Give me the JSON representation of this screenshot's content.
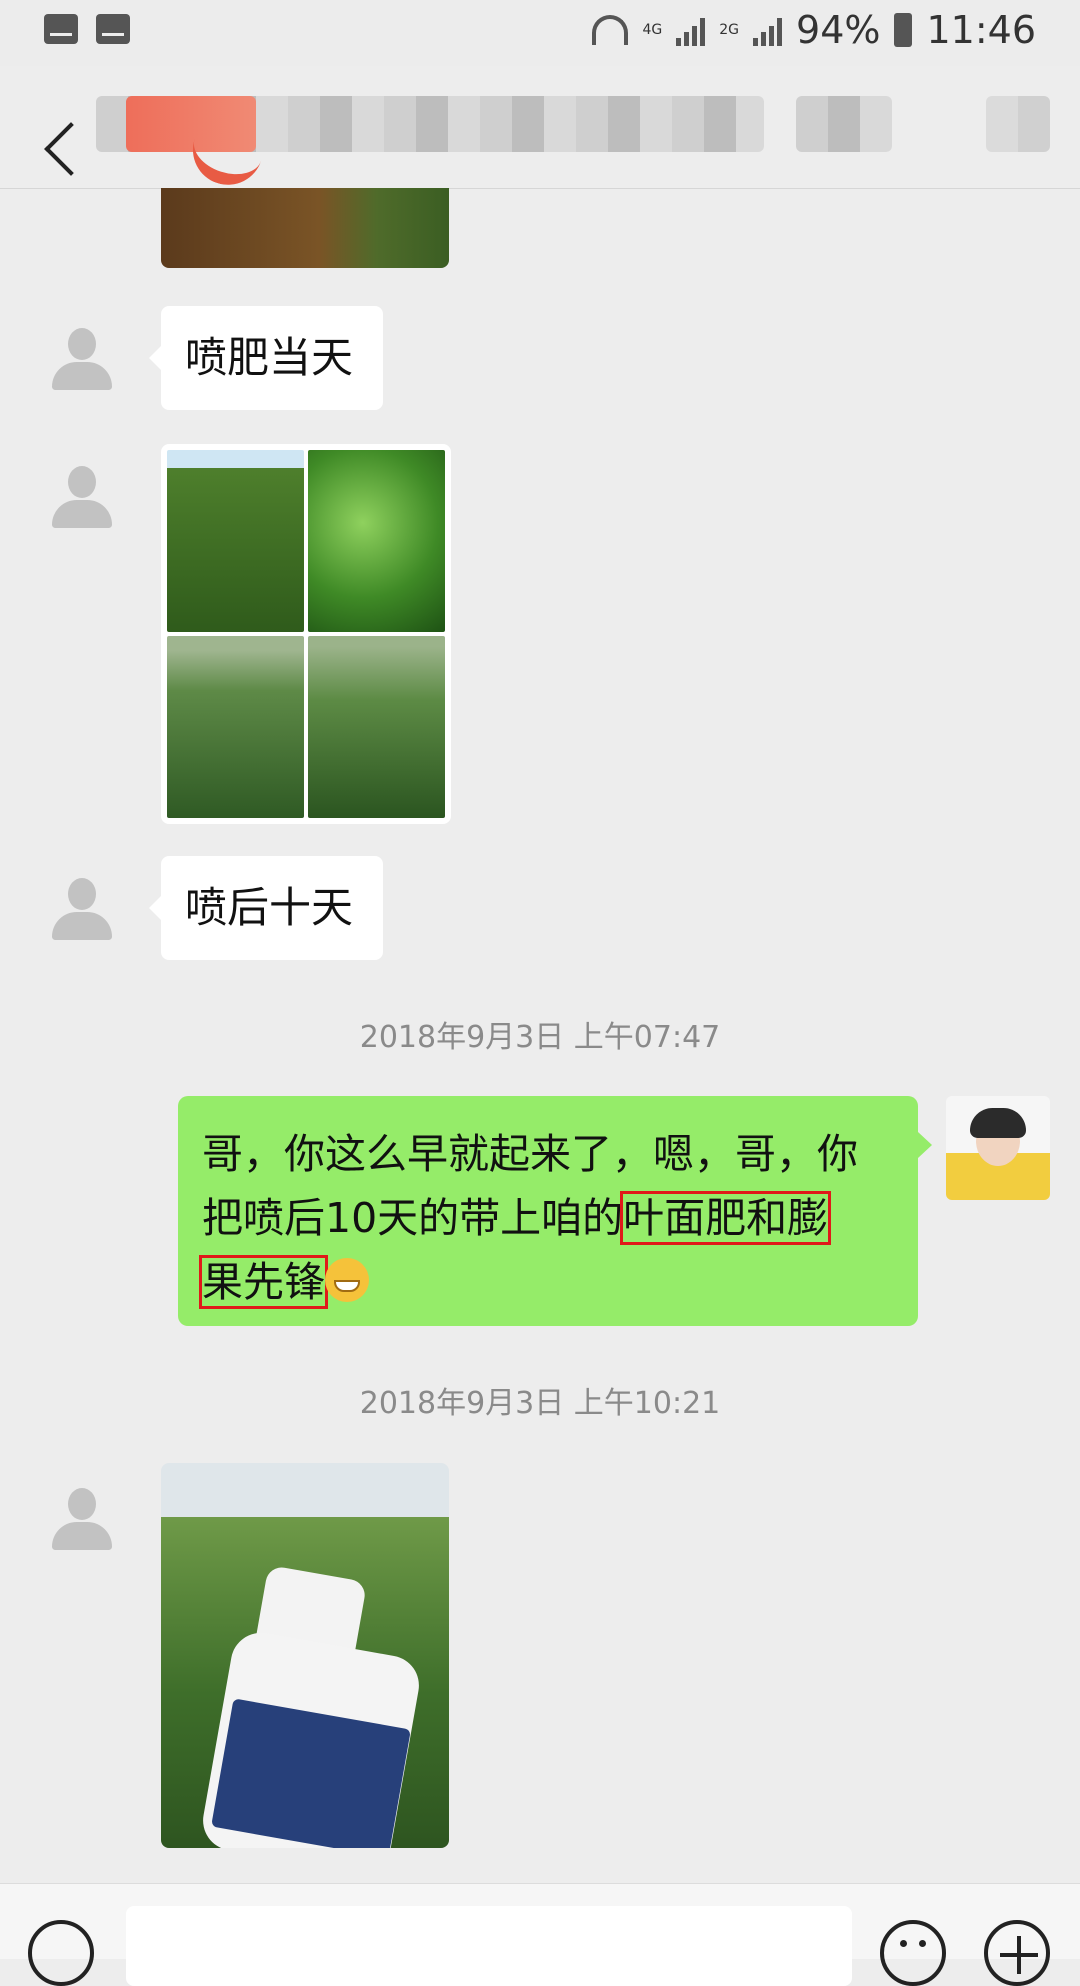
{
  "statusbar": {
    "battery": "94%",
    "time": "11:46",
    "net1": "4G",
    "net2": "2G"
  },
  "header": {
    "back_icon": "chevron-left-icon"
  },
  "messages": {
    "msg1": "喷肥当天",
    "msg2": "喷后十天",
    "ts1": "2018年9月3日 上午07:47",
    "me_part1": "哥，你这么早就起来了，嗯，哥，你把喷后10天的带上咱的",
    "me_hl1": "叶面肥和膨",
    "me_hl2": "果先锋",
    "ts2": "2018年9月3日 上午10:21"
  },
  "colors": {
    "me_bubble": "#95ec69",
    "highlight": "#e01919",
    "background": "#ededed"
  }
}
